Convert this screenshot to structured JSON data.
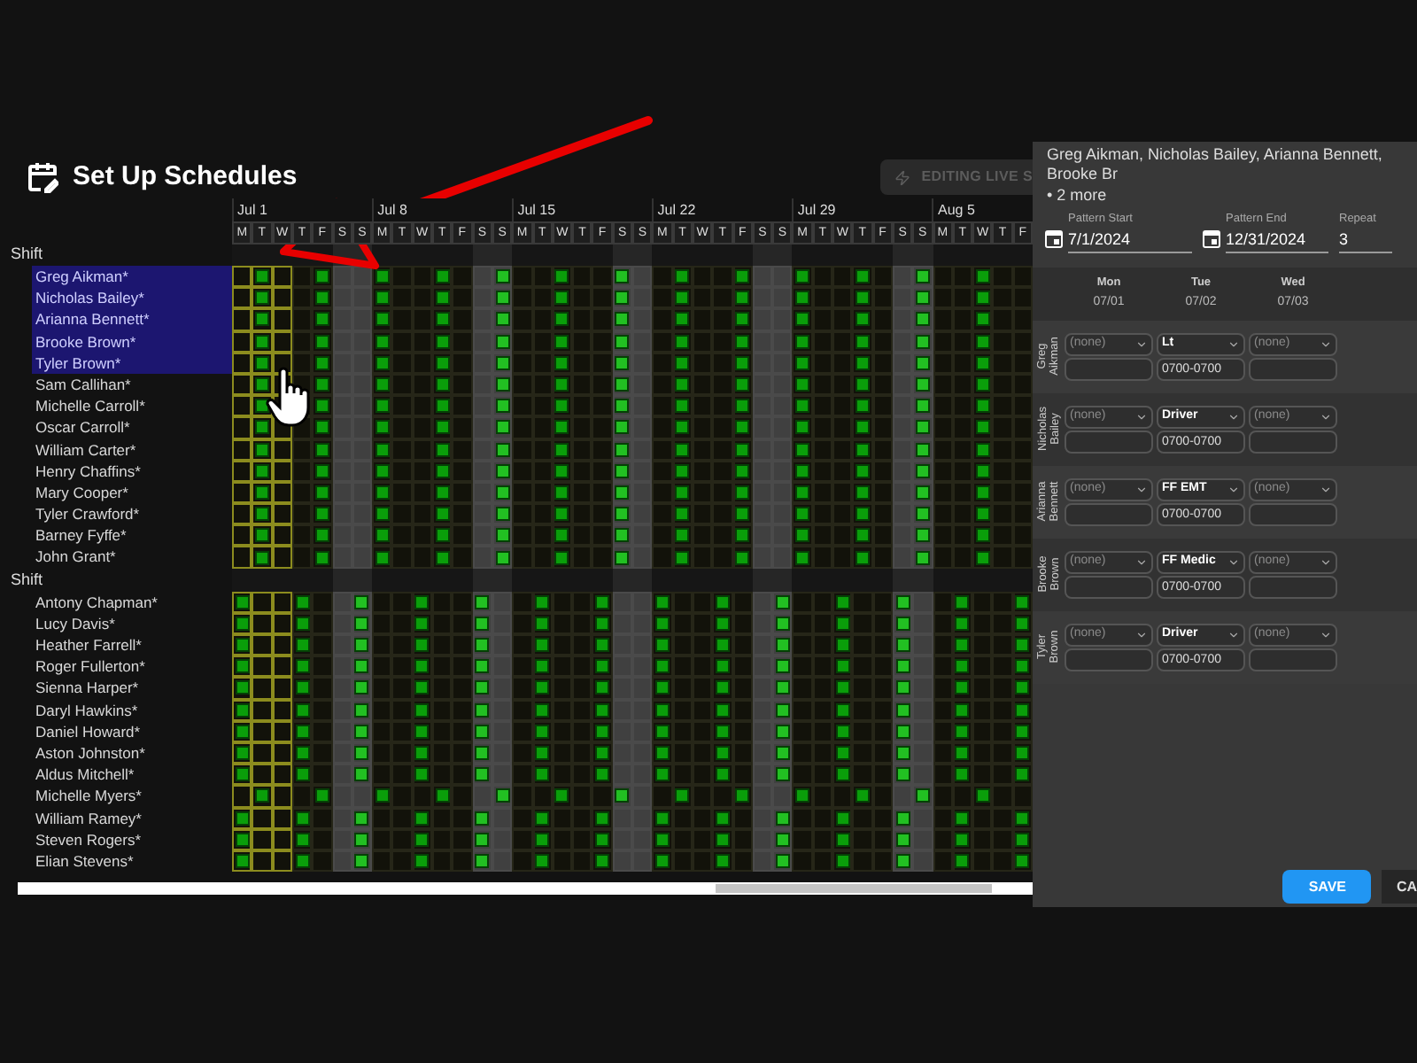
{
  "page": {
    "title": "Set Up Schedules",
    "live_button": "EDITING LIVE S"
  },
  "calendar": {
    "weeks": [
      {
        "label": "Jul 1",
        "days": [
          {
            "d": "M",
            "weekend": false
          },
          {
            "d": "T",
            "weekend": false
          },
          {
            "d": "W",
            "weekend": false
          },
          {
            "d": "T",
            "weekend": false
          },
          {
            "d": "F",
            "weekend": false
          },
          {
            "d": "S",
            "weekend": true
          },
          {
            "d": "S",
            "weekend": true
          }
        ]
      },
      {
        "label": "Jul 8",
        "days": [
          {
            "d": "M",
            "weekend": false
          },
          {
            "d": "T",
            "weekend": false
          },
          {
            "d": "W",
            "weekend": false
          },
          {
            "d": "T",
            "weekend": false
          },
          {
            "d": "F",
            "weekend": false
          },
          {
            "d": "S",
            "weekend": true
          },
          {
            "d": "S",
            "weekend": true
          }
        ]
      },
      {
        "label": "Jul 15",
        "days": [
          {
            "d": "M",
            "weekend": false
          },
          {
            "d": "T",
            "weekend": false
          },
          {
            "d": "W",
            "weekend": false
          },
          {
            "d": "T",
            "weekend": false
          },
          {
            "d": "F",
            "weekend": false
          },
          {
            "d": "S",
            "weekend": true
          },
          {
            "d": "S",
            "weekend": true
          }
        ]
      },
      {
        "label": "Jul 22",
        "days": [
          {
            "d": "M",
            "weekend": false
          },
          {
            "d": "T",
            "weekend": false
          },
          {
            "d": "W",
            "weekend": false
          },
          {
            "d": "T",
            "weekend": false
          },
          {
            "d": "F",
            "weekend": false
          },
          {
            "d": "S",
            "weekend": true
          },
          {
            "d": "S",
            "weekend": true
          }
        ]
      },
      {
        "label": "Jul 29",
        "days": [
          {
            "d": "M",
            "weekend": false
          },
          {
            "d": "T",
            "weekend": false
          },
          {
            "d": "W",
            "weekend": false
          },
          {
            "d": "T",
            "weekend": false
          },
          {
            "d": "F",
            "weekend": false
          },
          {
            "d": "S",
            "weekend": true
          },
          {
            "d": "S",
            "weekend": true
          }
        ]
      },
      {
        "label": "Aug 5",
        "days": [
          {
            "d": "M",
            "weekend": false
          },
          {
            "d": "T",
            "weekend": false
          },
          {
            "d": "W",
            "weekend": false
          },
          {
            "d": "T",
            "weekend": false
          },
          {
            "d": "F",
            "weekend": false
          }
        ]
      }
    ]
  },
  "groups": [
    {
      "label": "Shift",
      "people": [
        {
          "name": "Greg Aikman*",
          "selected": true,
          "kind": "b-rotation"
        },
        {
          "name": "Nicholas Bailey*",
          "selected": true,
          "kind": "b-rotation"
        },
        {
          "name": "Arianna Bennett*",
          "selected": true,
          "kind": "b-rotation"
        },
        {
          "name": "Brooke Brown*",
          "selected": true,
          "kind": "b-rotation"
        },
        {
          "name": "Tyler Brown*",
          "selected": true,
          "kind": "b-rotation"
        },
        {
          "name": "Sam Callihan*",
          "selected": false,
          "kind": "b-rotation"
        },
        {
          "name": "Michelle Carroll*",
          "selected": false,
          "kind": "b-rotation"
        },
        {
          "name": "Oscar Carroll*",
          "selected": false,
          "kind": "b-rotation"
        },
        {
          "name": "William Carter*",
          "selected": false,
          "kind": "b-rotation"
        },
        {
          "name": "Henry Chaffins*",
          "selected": false,
          "kind": "b-rotation"
        },
        {
          "name": "Mary Cooper*",
          "selected": false,
          "kind": "b-rotation"
        },
        {
          "name": "Tyler Crawford*",
          "selected": false,
          "kind": "b-rotation"
        },
        {
          "name": "Barney Fyffe*",
          "selected": false,
          "kind": "b-rotation"
        },
        {
          "name": "John Grant*",
          "selected": false,
          "kind": "b-rotation"
        }
      ]
    },
    {
      "label": "Shift",
      "people": [
        {
          "name": "Antony Chapman*",
          "selected": false,
          "kind": "a-rotation"
        },
        {
          "name": "Lucy Davis*",
          "selected": false,
          "kind": "a-rotation"
        },
        {
          "name": "Heather Farrell*",
          "selected": false,
          "kind": "a-rotation"
        },
        {
          "name": "Roger Fullerton*",
          "selected": false,
          "kind": "a-rotation"
        },
        {
          "name": "Sienna Harper*",
          "selected": false,
          "kind": "a-rotation"
        },
        {
          "name": "Daryl Hawkins*",
          "selected": false,
          "kind": "a-rotation"
        },
        {
          "name": "Daniel Howard*",
          "selected": false,
          "kind": "a-rotation"
        },
        {
          "name": "Aston Johnston*",
          "selected": false,
          "kind": "a-rotation"
        },
        {
          "name": "Aldus Mitchell*",
          "selected": false,
          "kind": "a-rotation"
        },
        {
          "name": "Michelle Myers*",
          "selected": false,
          "kind": "b-rotation"
        },
        {
          "name": "William Ramey*",
          "selected": false,
          "kind": "a-rotation"
        },
        {
          "name": "Steven Rogers*",
          "selected": false,
          "kind": "a-rotation"
        },
        {
          "name": "Elian Stevens*",
          "selected": false,
          "kind": "a-rotation"
        }
      ]
    }
  ],
  "panel": {
    "summary": "Greg Aikman, Nicholas Bailey, Arianna Bennett, Brooke Br",
    "more": "• 2 more",
    "fields": [
      {
        "label": "Pattern Start",
        "value": "7/1/2024",
        "kind": "date"
      },
      {
        "label": "Pattern End",
        "value": "12/31/2024",
        "kind": "date"
      },
      {
        "label": "Repeat",
        "value": "3",
        "kind": "number"
      }
    ],
    "days": [
      {
        "day": "Mon",
        "date": "07/01"
      },
      {
        "day": "Tue",
        "date": "07/02"
      },
      {
        "day": "Wed",
        "date": "07/03"
      }
    ],
    "assignments": [
      {
        "name": "Greg Aikman",
        "slots": [
          {
            "role": "(none)"
          },
          {
            "role": "Lt",
            "time": "0700-0700"
          },
          {
            "role": "(none)"
          }
        ]
      },
      {
        "name": "Nicholas Bailey",
        "slots": [
          {
            "role": "(none)"
          },
          {
            "role": "Driver",
            "time": "0700-0700"
          },
          {
            "role": "(none)"
          }
        ]
      },
      {
        "name": "Arianna Bennett",
        "slots": [
          {
            "role": "(none)"
          },
          {
            "role": "FF EMT",
            "time": "0700-0700"
          },
          {
            "role": "(none)"
          }
        ]
      },
      {
        "name": "Brooke Brown",
        "slots": [
          {
            "role": "(none)"
          },
          {
            "role": "FF Medic",
            "time": "0700-0700"
          },
          {
            "role": "(none)"
          }
        ]
      },
      {
        "name": "Tyler Brown",
        "slots": [
          {
            "role": "(none)"
          },
          {
            "role": "Driver",
            "time": "0700-0700"
          },
          {
            "role": "(none)"
          }
        ]
      }
    ],
    "buttons": [
      {
        "label": "SAVE",
        "kind": "primary"
      },
      {
        "label": "CA",
        "kind": "secondary"
      }
    ]
  }
}
